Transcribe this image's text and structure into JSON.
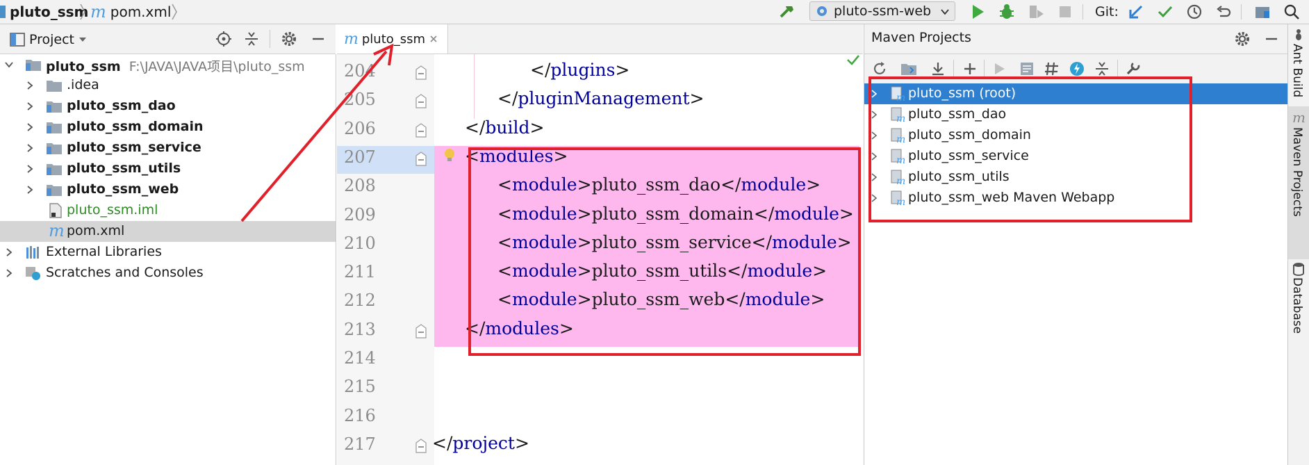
{
  "breadcrumb": {
    "project": "pluto_ssm",
    "file": "pom.xml",
    "file_icon": "m"
  },
  "run_config": {
    "label": "pluto-ssm-web"
  },
  "vcs": {
    "label": "Git:"
  },
  "project_panel": {
    "title": "Project",
    "tree": [
      {
        "label": "pluto_ssm",
        "hint": "F:\\JAVA\\JAVA项目\\pluto_ssm",
        "icon": "module-folder-icon",
        "bold": true
      },
      {
        "label": ".idea",
        "icon": "folder-icon",
        "bold": false
      },
      {
        "label": "pluto_ssm_dao",
        "icon": "module-folder-icon",
        "bold": true
      },
      {
        "label": "pluto_ssm_domain",
        "icon": "module-folder-icon",
        "bold": true
      },
      {
        "label": "pluto_ssm_service",
        "icon": "module-folder-icon",
        "bold": true
      },
      {
        "label": "pluto_ssm_utils",
        "icon": "module-folder-icon",
        "bold": true
      },
      {
        "label": "pluto_ssm_web",
        "icon": "module-folder-icon",
        "bold": true
      },
      {
        "label": "pluto_ssm.iml",
        "icon": "iml-file-icon",
        "bold": false
      },
      {
        "label": "pom.xml",
        "icon": "maven-file-icon",
        "bold": false,
        "selected": true
      },
      {
        "label": "External Libraries",
        "icon": "libraries-icon",
        "bold": false
      },
      {
        "label": "Scratches and Consoles",
        "icon": "scratches-icon",
        "bold": false
      }
    ]
  },
  "editor": {
    "tab": {
      "label": "pluto_ssm",
      "icon": "m"
    },
    "lines": [
      {
        "num": "204",
        "code": "</plugins>"
      },
      {
        "num": "205",
        "code": "</pluginManagement>"
      },
      {
        "num": "206",
        "code": "</build>"
      },
      {
        "num": "207",
        "code": "<modules>"
      },
      {
        "num": "208",
        "code": "<module>pluto_ssm_dao</module>"
      },
      {
        "num": "209",
        "code": "<module>pluto_ssm_domain</module>"
      },
      {
        "num": "210",
        "code": "<module>pluto_ssm_service</module>"
      },
      {
        "num": "211",
        "code": "<module>pluto_ssm_utils</module>"
      },
      {
        "num": "212",
        "code": "<module>pluto_ssm_web</module>"
      },
      {
        "num": "213",
        "code": "</modules>"
      },
      {
        "num": "214",
        "code": ""
      },
      {
        "num": "215",
        "code": ""
      },
      {
        "num": "216",
        "code": ""
      },
      {
        "num": "217",
        "code": "</project>"
      }
    ]
  },
  "maven_panel": {
    "title": "Maven Projects",
    "projects": [
      {
        "label": "pluto_ssm (root)",
        "selected": true
      },
      {
        "label": "pluto_ssm_dao"
      },
      {
        "label": "pluto_ssm_domain"
      },
      {
        "label": "pluto_ssm_service"
      },
      {
        "label": "pluto_ssm_utils"
      },
      {
        "label": "pluto_ssm_web Maven Webapp"
      }
    ]
  },
  "side_tabs": {
    "ant": "Ant Build",
    "maven": "Maven Projects",
    "database": "Database"
  },
  "colors": {
    "selection_blue": "#2f7fd1",
    "code_highlight": "#ffb8ee",
    "annotation_red": "#e0202a"
  }
}
